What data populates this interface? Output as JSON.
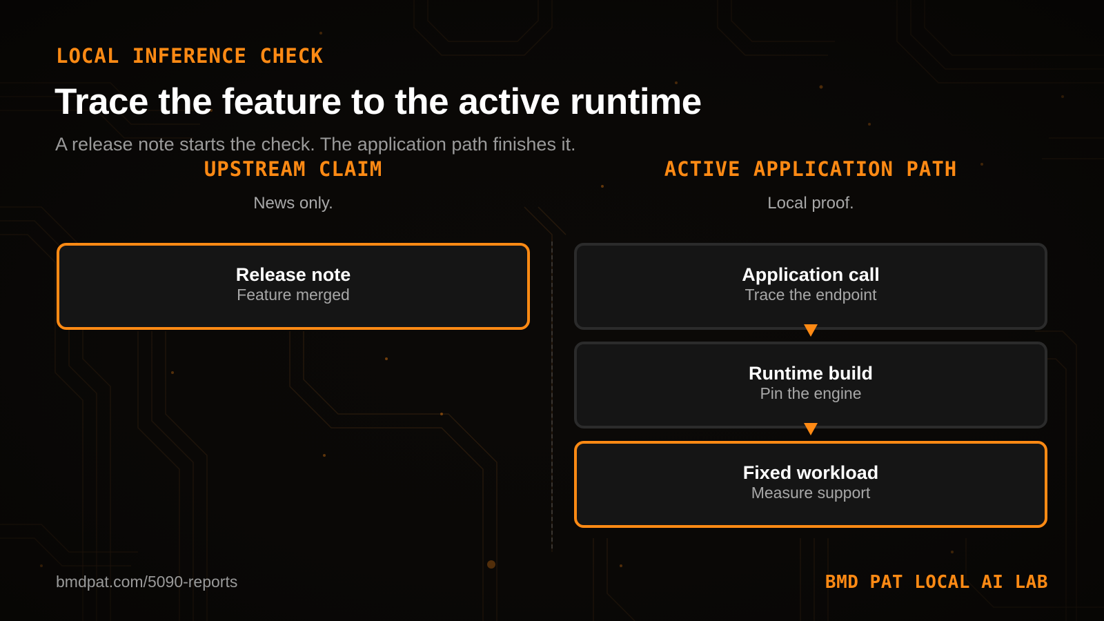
{
  "colors": {
    "accent": "#ff8a14",
    "background": "#0b0907",
    "card": "#151515",
    "card_border": "#2b2b2b"
  },
  "header": {
    "kicker": "LOCAL INFERENCE CHECK",
    "title": "Trace the feature to the active runtime",
    "subtitle": "A release note starts the check. The application path finishes it."
  },
  "left_column": {
    "heading": "UPSTREAM CLAIM",
    "subheading": "News only.",
    "cards": [
      {
        "title": "Release note",
        "subtitle": "Feature merged",
        "highlighted": true
      }
    ]
  },
  "right_column": {
    "heading": "ACTIVE APPLICATION PATH",
    "subheading": "Local proof.",
    "cards": [
      {
        "title": "Application call",
        "subtitle": "Trace the endpoint",
        "highlighted": false
      },
      {
        "title": "Runtime build",
        "subtitle": "Pin the engine",
        "highlighted": false
      },
      {
        "title": "Fixed workload",
        "subtitle": "Measure support",
        "highlighted": true
      }
    ]
  },
  "footer": {
    "url": "bmdpat.com/5090-reports",
    "brand": "BMD PAT LOCAL AI LAB"
  }
}
